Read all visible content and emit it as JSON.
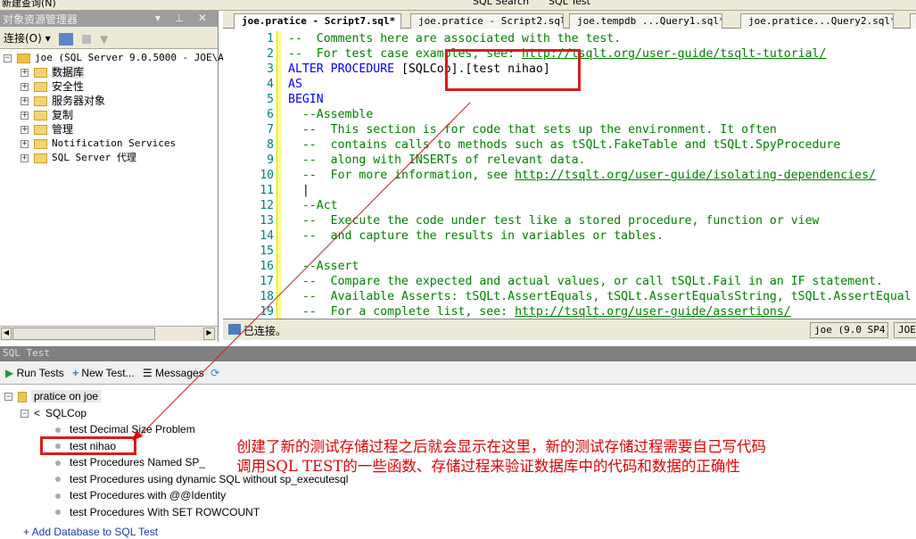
{
  "toolbar": {
    "new_query": "新建查询(N)",
    "sql_search": "SQL Search",
    "sql_test": "SQL Test"
  },
  "object_explorer": {
    "title": "对象资源管理器",
    "connect_label": "连接(O) ▾",
    "server": "joe (SQL Server 9.0.5000 - JOE\\Adr",
    "nodes": [
      "数据库",
      "安全性",
      "服务器对象",
      "复制",
      "管理",
      "Notification Services",
      "SQL Server 代理"
    ]
  },
  "editor": {
    "tabs": [
      "joe.pratice - Script7.sql*",
      "joe.pratice - Script2.sql*",
      "joe.tempdb ...Query1.sql*",
      "joe.pratice...Query2.sql*",
      "对"
    ],
    "lines": [
      [
        {
          "t": "--  Comments here are associated with the test.",
          "c": "c"
        }
      ],
      [
        {
          "t": "--  For test case examples, see: ",
          "c": "c"
        },
        {
          "t": "http://tsqlt.org/user-guide/tsqlt-tutorial/",
          "c": "u"
        }
      ],
      [
        {
          "t": "ALTER PROCEDURE ",
          "c": "k"
        },
        {
          "t": "[SQLCop].[test nihao]",
          "c": "p"
        }
      ],
      [
        {
          "t": "AS",
          "c": "k"
        }
      ],
      [
        {
          "t": "BEGIN",
          "c": "k"
        }
      ],
      [
        {
          "t": "  --Assemble",
          "c": "c"
        }
      ],
      [
        {
          "t": "  --  This section is for code that sets up the environment. It often",
          "c": "c"
        }
      ],
      [
        {
          "t": "  --  contains calls to methods such as tSQLt.FakeTable and tSQLt.SpyProcedure",
          "c": "c"
        }
      ],
      [
        {
          "t": "  --  along with INSERTs of relevant data.",
          "c": "c"
        }
      ],
      [
        {
          "t": "  --  For more information, see ",
          "c": "c"
        },
        {
          "t": "http://tsqlt.org/user-guide/isolating-dependencies/",
          "c": "u"
        }
      ],
      [
        {
          "t": "  |",
          "c": "p"
        }
      ],
      [
        {
          "t": "  --Act",
          "c": "c"
        }
      ],
      [
        {
          "t": "  --  Execute the code under test like a stored procedure, function or view",
          "c": "c"
        }
      ],
      [
        {
          "t": "  --  and capture the results in variables or tables.",
          "c": "c"
        }
      ],
      [
        {
          "t": "",
          "c": "c"
        }
      ],
      [
        {
          "t": "  --Assert",
          "c": "c"
        }
      ],
      [
        {
          "t": "  --  Compare the expected and actual values, or call tSQLt.Fail in an IF statement.",
          "c": "c"
        }
      ],
      [
        {
          "t": "  --  Available Asserts: tSQLt.AssertEquals, tSQLt.AssertEqualsString, tSQLt.AssertEqual",
          "c": "c"
        }
      ],
      [
        {
          "t": "  --  For a complete list, see: ",
          "c": "c"
        },
        {
          "t": "http://tsqlt.org/user-guide/assertions/",
          "c": "u"
        }
      ]
    ],
    "status": {
      "connected": "已连接。",
      "server": "joe (9.0 SP4)",
      "instance": "JOE"
    }
  },
  "sql_test": {
    "title": "SQL Test",
    "run_tests": "Run Tests",
    "new_test": "New Test...",
    "messages": "Messages",
    "database": "pratice on joe",
    "schema": "SQLCop",
    "tests": [
      "test Decimal Size Problem",
      "test nihao",
      "test Procedures Named SP_",
      "test Procedures using dynamic SQL without sp_executesql",
      "test Procedures with @@Identity",
      "test Procedures With SET ROWCOUNT"
    ],
    "add_database": "+ Add Database to SQL Test"
  },
  "annotation": {
    "line1": "创建了新的测试存储过程之后就会显示在这里，新的测试存储过程需要自己写代码",
    "line2": "调用SQL TEST的一些函数、存储过程来验证数据库中的代码和数据的正确性",
    "color": "#e00000"
  }
}
